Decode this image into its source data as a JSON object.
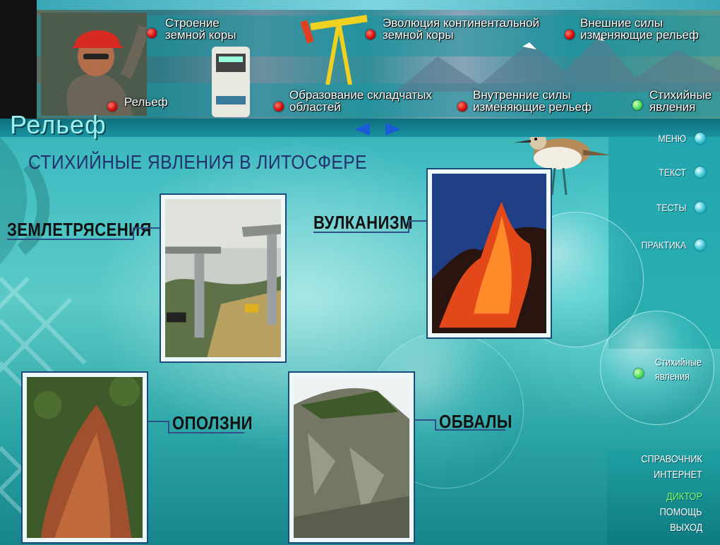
{
  "app": {
    "section_title": "Рельеф",
    "page_heading": "СТИХИЙНЫЕ ЯВЛЕНИЯ В ЛИТОСФЕРЕ"
  },
  "top_nav": {
    "row1": [
      {
        "label": "Строение земной коры",
        "dot": "red"
      },
      {
        "label": "Эволюция континентальной земной коры",
        "dot": "red"
      },
      {
        "label": "Внешние силы изменяющие рельеф",
        "dot": "red"
      }
    ],
    "row2": [
      {
        "label": "Рельеф",
        "dot": "red"
      },
      {
        "label": "Образование складчатых областей",
        "dot": "red"
      },
      {
        "label": "Внутренние силы изменяющие рельеф",
        "dot": "red"
      },
      {
        "label": "Стихийные явления",
        "dot": "green"
      }
    ]
  },
  "pager": {
    "prev_icon": "arrow-left-icon",
    "next_icon": "arrow-right-icon"
  },
  "topics": [
    {
      "label": "ЗЕМЛЕТРЯСЕНИЯ",
      "photo": "collapsed-bridge-photo"
    },
    {
      "label": "ВУЛКАНИЗМ",
      "photo": "erupting-volcano-photo"
    },
    {
      "label": "ОПОЛЗНИ",
      "photo": "landslide-slope-photo"
    },
    {
      "label": "ОБВАЛЫ",
      "photo": "rockfall-cliff-photo"
    }
  ],
  "side_menu": [
    {
      "label": "МЕНЮ"
    },
    {
      "label": "ТЕКСТ"
    },
    {
      "label": "ТЕСТЫ"
    },
    {
      "label": "ПРАКТИКА"
    }
  ],
  "side_current": {
    "line1": "Стихийные",
    "line2": "явления",
    "dot": "green"
  },
  "bottom_menu": [
    {
      "label": "СПРАВОЧНИК",
      "active": false
    },
    {
      "label": "ИНТЕРНЕТ",
      "active": false
    },
    {
      "label": "ДИКТОР",
      "active": true
    },
    {
      "label": "ПОМОЩЬ",
      "active": false
    },
    {
      "label": "ВЫХОД",
      "active": false
    }
  ],
  "colors": {
    "accent_red": "#d10f0f",
    "accent_green": "#4ee05a",
    "heading": "#23316e",
    "teal": "#1ea0a8"
  }
}
